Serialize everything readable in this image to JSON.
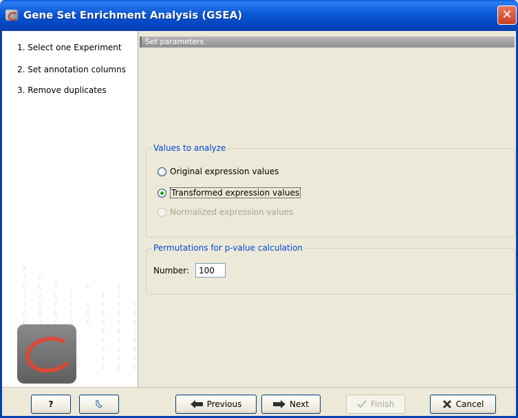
{
  "window": {
    "title": "Gene Set Enrichment Analysis (GSEA)",
    "close_glyph": "✕"
  },
  "sidebar": {
    "steps": [
      {
        "label": "1.  Select one Experiment"
      },
      {
        "label": "2.  Set annotation columns"
      },
      {
        "label": "3.  Remove duplicates"
      }
    ]
  },
  "main": {
    "section_title": "Set parameters",
    "values_group": {
      "title": "Values to analyze",
      "options": [
        {
          "label": "Original expression values",
          "checked": false,
          "disabled": false
        },
        {
          "label": "Transformed expression values",
          "checked": true,
          "disabled": false
        },
        {
          "label": "Normalized expression values",
          "checked": false,
          "disabled": true
        }
      ]
    },
    "permutations_group": {
      "title": "Permutations for p-value calculation",
      "number_label": "Number:",
      "number_value": "100"
    }
  },
  "footer": {
    "help_label": "?",
    "previous_label": "Previous",
    "next_label": "Next",
    "finish_label": "Finish",
    "cancel_label": "Cancel"
  },
  "colors": {
    "titlebar": "#0b58d6",
    "group_title": "#0046d5",
    "radio_checked": "#21a121",
    "disabled_text": "#a7a696"
  }
}
